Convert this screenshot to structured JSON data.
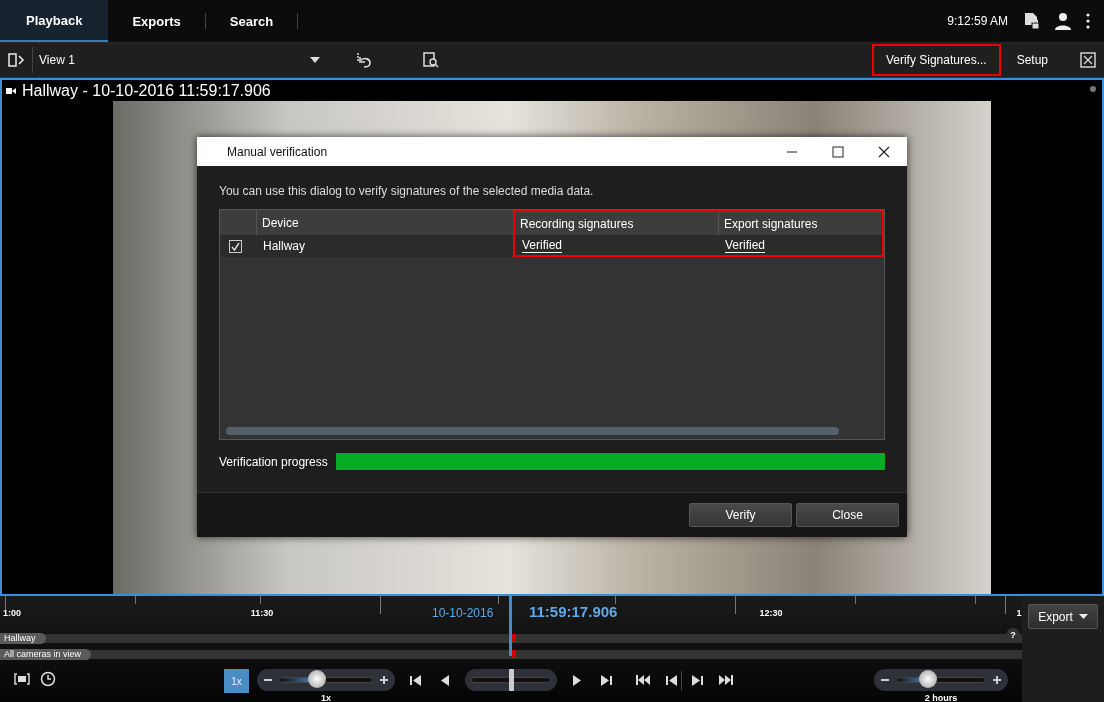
{
  "tabs": [
    {
      "label": "Playback",
      "selected": true
    },
    {
      "label": "Exports",
      "selected": false
    },
    {
      "label": "Search",
      "selected": false
    }
  ],
  "clock": "9:12:59 AM",
  "toolbar": {
    "view": "View 1",
    "buttons": [
      {
        "label": "Verify Signatures...",
        "highlighted": true
      },
      {
        "label": "Setup",
        "highlighted": false
      }
    ]
  },
  "camera": {
    "title": "Hallway - 10-10-2016 11:59:17.906"
  },
  "dialog": {
    "title": "Manual verification",
    "intro": "You can use this dialog to verify signatures of the selected media data.",
    "table": {
      "columns": [
        {
          "label": "Device",
          "highlighted": false
        },
        {
          "label": "Recording signatures",
          "highlighted": true
        },
        {
          "label": "Export signatures",
          "highlighted": true
        }
      ],
      "rows": [
        {
          "checked": true,
          "cells": [
            "Hallway",
            "Verified",
            "Verified"
          ]
        }
      ]
    },
    "progress": {
      "label": "Verification progress",
      "level": 1
    },
    "buttons": [
      "Verify",
      "Close"
    ]
  },
  "timeline": {
    "labels": [
      "1:00",
      "11:30",
      "12:30",
      "1"
    ],
    "date": "10-10-2016",
    "time": "11:59:17.906",
    "tracks": [
      "Hallway",
      "All cameras in view"
    ],
    "help": "?",
    "speed": {
      "button": "1x",
      "level": 0.4,
      "reading": "1x"
    },
    "jog": {
      "level": 0.5
    },
    "zoom": {
      "level": 0.35,
      "reading": "2 hours"
    },
    "export": "Export"
  }
}
